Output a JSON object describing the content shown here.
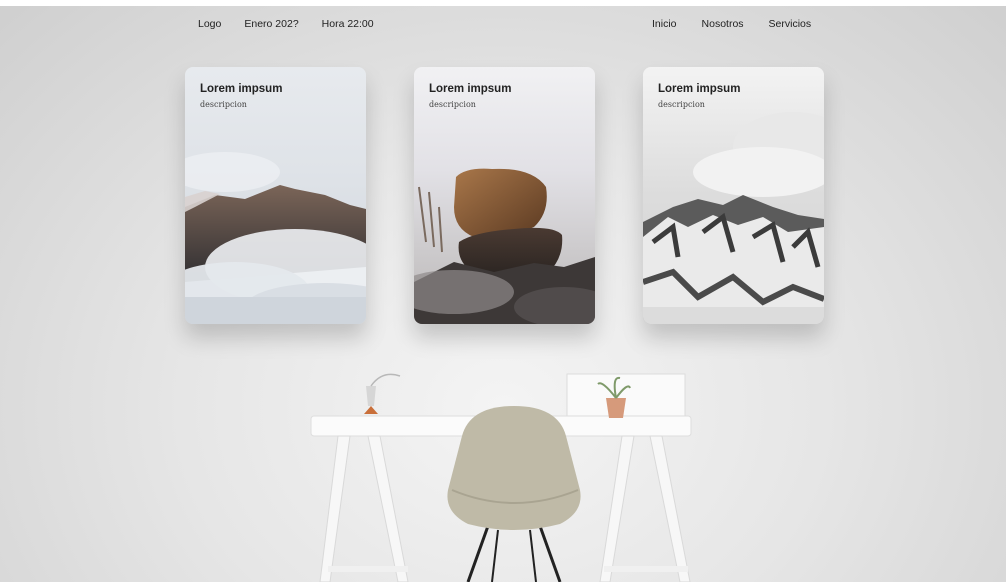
{
  "nav": {
    "left": {
      "logo": "Logo",
      "date": "Enero 202?",
      "time": "Hora 22:00"
    },
    "right": {
      "home": "Inicio",
      "about": "Nosotros",
      "services": "Servicios"
    }
  },
  "cards": [
    {
      "title": "Lorem impsum",
      "description": "descripcion"
    },
    {
      "title": "Lorem impsum",
      "description": "descripcion"
    },
    {
      "title": "Lorem impsum",
      "description": "descripcion"
    }
  ]
}
